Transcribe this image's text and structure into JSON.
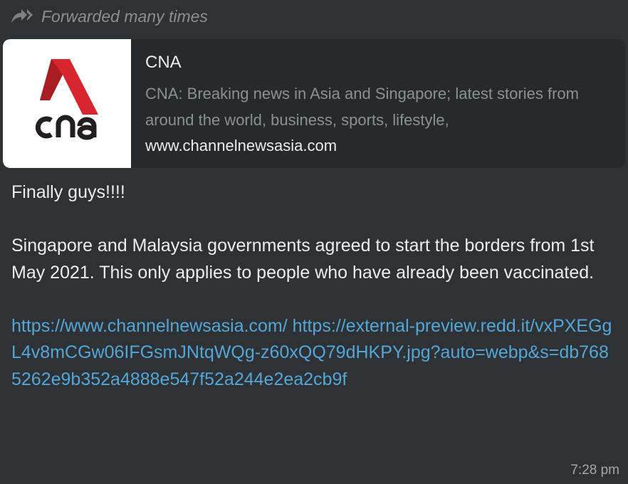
{
  "forwarded": {
    "label": "Forwarded many times",
    "icon": "forward-arrows-icon"
  },
  "preview": {
    "logo_text": "cna",
    "logo_icon": "cna-logo-icon",
    "title": "CNA",
    "description": "CNA: Breaking news in Asia and Singapore; latest stories from around the world, business, sports, lifestyle,",
    "domain": "www.channelnewsasia.com",
    "logo_color": "#d8262e"
  },
  "message": {
    "line1": "Finally guys!!!!",
    "line2": "Singapore and Malaysia governments agreed to start the borders from 1st May 2021. This only applies to people who have already been vaccinated.",
    "link1": "https://www.channelnewsasia.com/",
    "link2": "https://external-preview.redd.it/vxPXEGgL4v8mCGw06IFGsmJNtqWQg-z60xQQ79dHKPY.jpg?auto=webp&s=db7685262e9b352a4888e547f52a244e2ea2cb9f"
  },
  "timestamp": "7:28 pm",
  "colors": {
    "bubble_bg": "#2f3235",
    "preview_bg": "#262a2d",
    "link": "#53a6d8"
  }
}
